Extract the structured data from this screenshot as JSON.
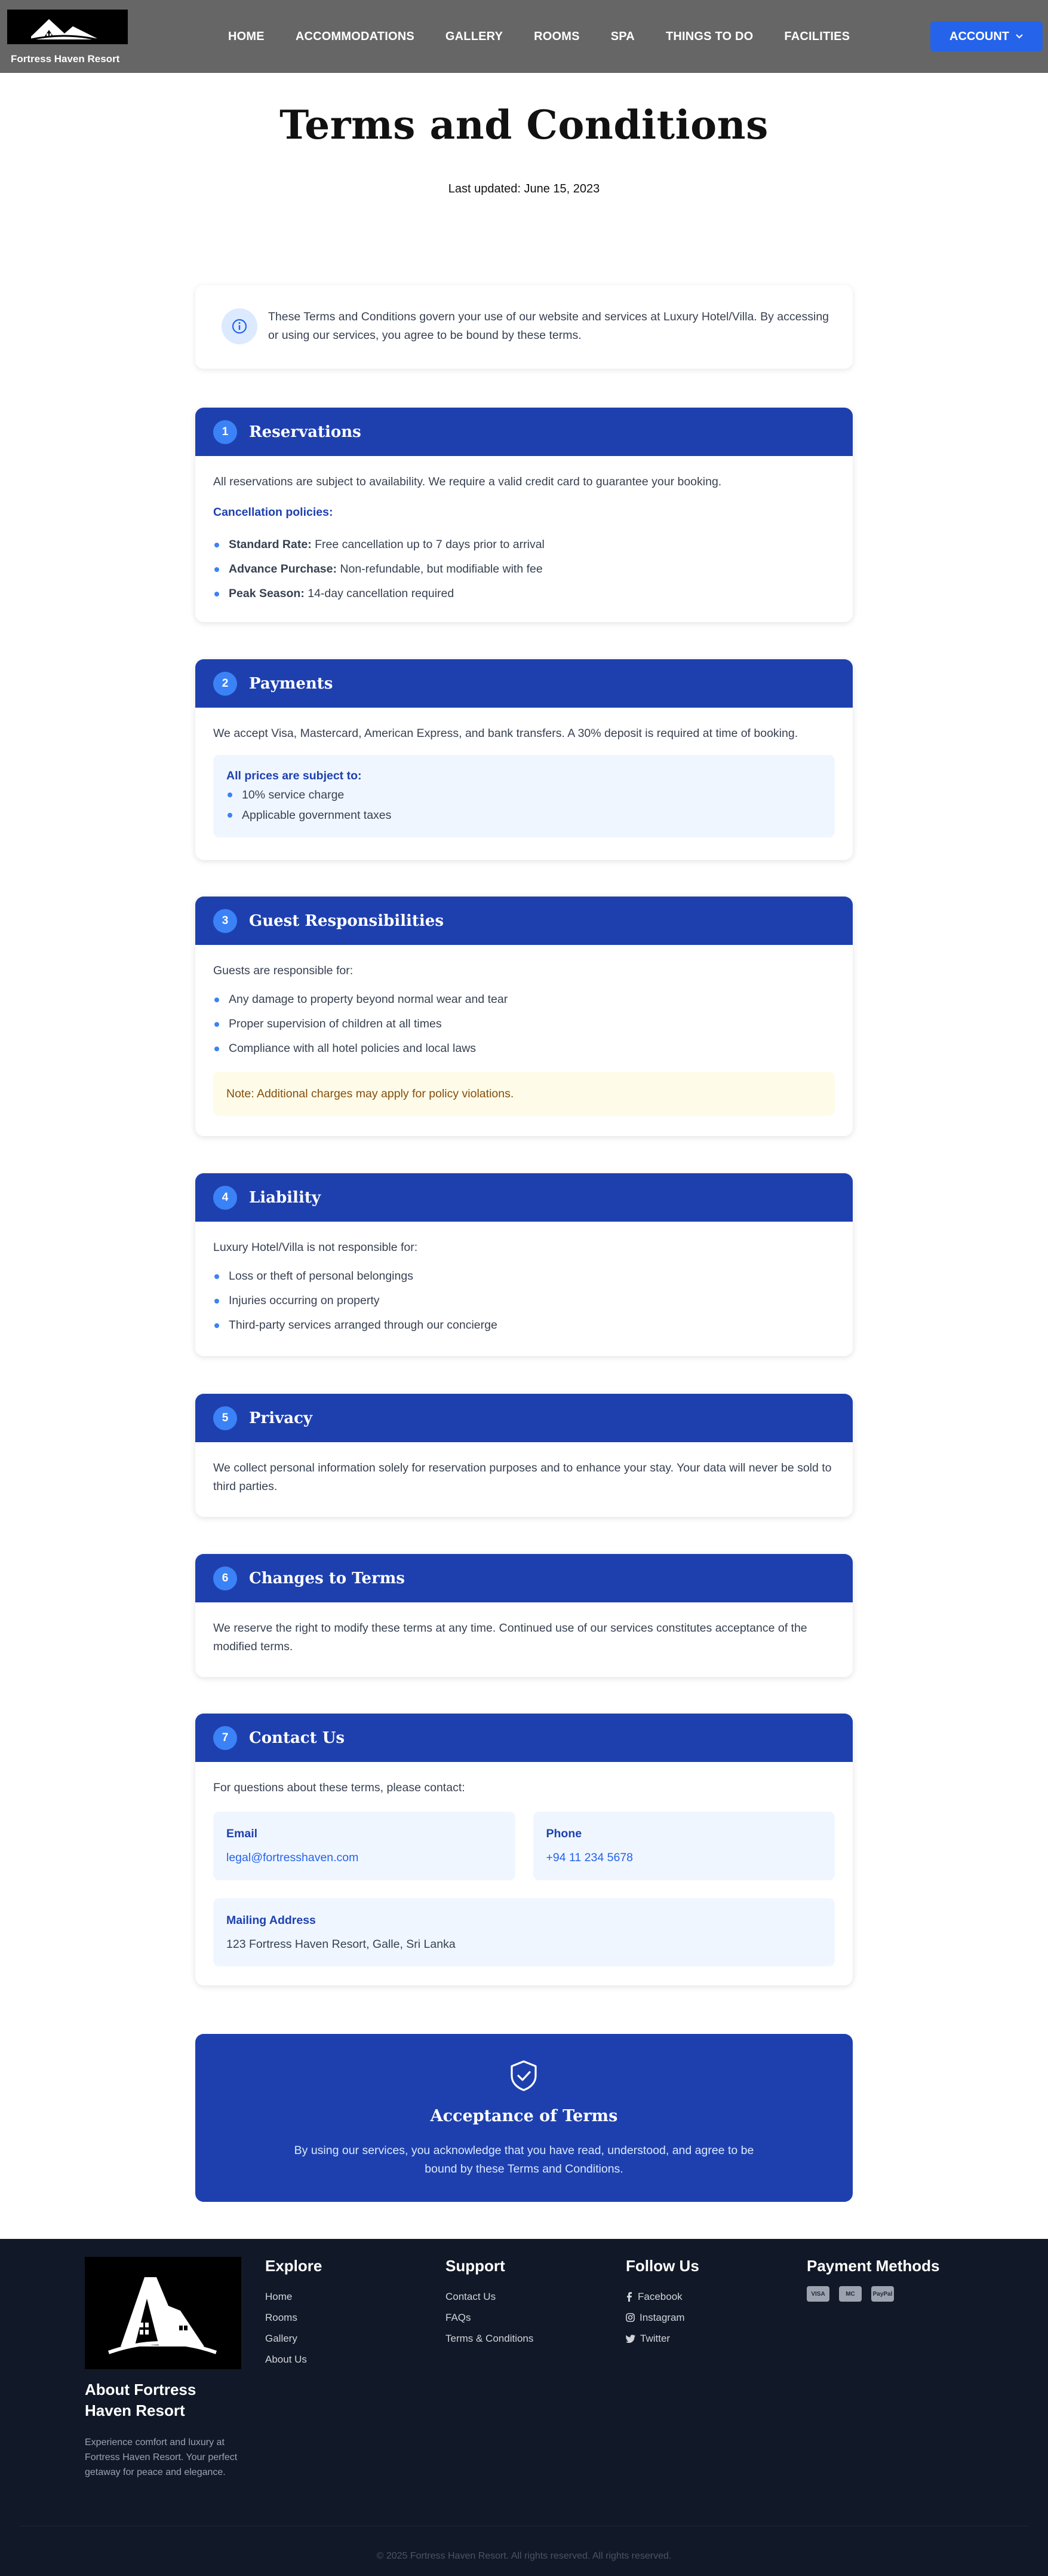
{
  "header": {
    "brand": "Fortress Haven Resort",
    "nav": [
      "HOME",
      "ACCOMMODATIONS",
      "GALLERY",
      "ROOMS",
      "SPA",
      "THINGS TO DO",
      "FACILITIES"
    ],
    "account_label": "ACCOUNT"
  },
  "page": {
    "title": "Terms and Conditions",
    "updated": "Last updated: June 15, 2023",
    "intro": "These Terms and Conditions govern your use of our website and services at Luxury Hotel/Villa. By accessing or using our services, you agree to be bound by these terms."
  },
  "sections": {
    "reservations": {
      "num": "1",
      "title": "Reservations",
      "text": "All reservations are subject to availability. We require a valid credit card to guarantee your booking.",
      "policy_title": "Cancellation policies:",
      "policies": [
        {
          "term": "Standard Rate:",
          "desc": " Free cancellation up to 7 days prior to arrival"
        },
        {
          "term": "Advance Purchase:",
          "desc": " Non-refundable, but modifiable with fee"
        },
        {
          "term": "Peak Season:",
          "desc": " 14-day cancellation required"
        }
      ]
    },
    "payments": {
      "num": "2",
      "title": "Payments",
      "text": "We accept Visa, Mastercard, American Express, and bank transfers. A 30% deposit is required at time of booking.",
      "box_title": "All prices are subject to:",
      "items": [
        "10% service charge",
        "Applicable government taxes"
      ]
    },
    "guest": {
      "num": "3",
      "title": "Guest Responsibilities",
      "text": "Guests are responsible for:",
      "items": [
        "Any damage to property beyond normal wear and tear",
        "Proper supervision of children at all times",
        "Compliance with all hotel policies and local laws"
      ],
      "note": "Note: Additional charges may apply for policy violations."
    },
    "liability": {
      "num": "4",
      "title": "Liability",
      "text": "Luxury Hotel/Villa is not responsible for:",
      "items": [
        "Loss or theft of personal belongings",
        "Injuries occurring on property",
        "Third-party services arranged through our concierge"
      ]
    },
    "privacy": {
      "num": "5",
      "title": "Privacy",
      "text": "We collect personal information solely for reservation purposes and to enhance your stay. Your data will never be sold to third parties."
    },
    "changes": {
      "num": "6",
      "title": "Changes to Terms",
      "text": "We reserve the right to modify these terms at any time. Continued use of our services constitutes acceptance of the modified terms."
    },
    "contact": {
      "num": "7",
      "title": "Contact Us",
      "text": "For questions about these terms, please contact:",
      "email_label": "Email",
      "email": "legal@fortresshaven.com",
      "phone_label": "Phone",
      "phone": "+94 11 234 5678",
      "address_label": "Mailing Address",
      "address": "123 Fortress Haven Resort, Galle, Sri Lanka"
    }
  },
  "acceptance": {
    "title": "Acceptance of Terms",
    "text": "By using our services, you acknowledge that you have read, understood, and agree to be bound by these Terms and Conditions."
  },
  "footer": {
    "about_title": "About Fortress Haven Resort",
    "about_text": "Experience comfort and luxury at Fortress Haven Resort. Your perfect getaway for peace and elegance.",
    "explore_title": "Explore",
    "explore": [
      "Home",
      "Rooms",
      "Gallery",
      "About Us"
    ],
    "support_title": "Support",
    "support": [
      "Contact Us",
      "FAQs",
      "Terms & Conditions"
    ],
    "follow_title": "Follow Us",
    "follow": [
      {
        "icon": "facebook-icon",
        "label": "Facebook"
      },
      {
        "icon": "instagram-icon",
        "label": "Instagram"
      },
      {
        "icon": "twitter-icon",
        "label": "Twitter"
      }
    ],
    "payment_title": "Payment Methods",
    "payment_icons": [
      "visa-icon",
      "mastercard-icon",
      "paypal-icon"
    ],
    "payment_labels": [
      "VISA",
      "MC",
      "PayPal"
    ],
    "copyright": "© 2025 Fortress Haven Resort. All rights reserved. All rights reserved."
  },
  "colors": {
    "header_bg": "#666666",
    "accent_blue": "#1e40af",
    "button_blue": "#2563eb",
    "footer_bg": "#111827"
  }
}
